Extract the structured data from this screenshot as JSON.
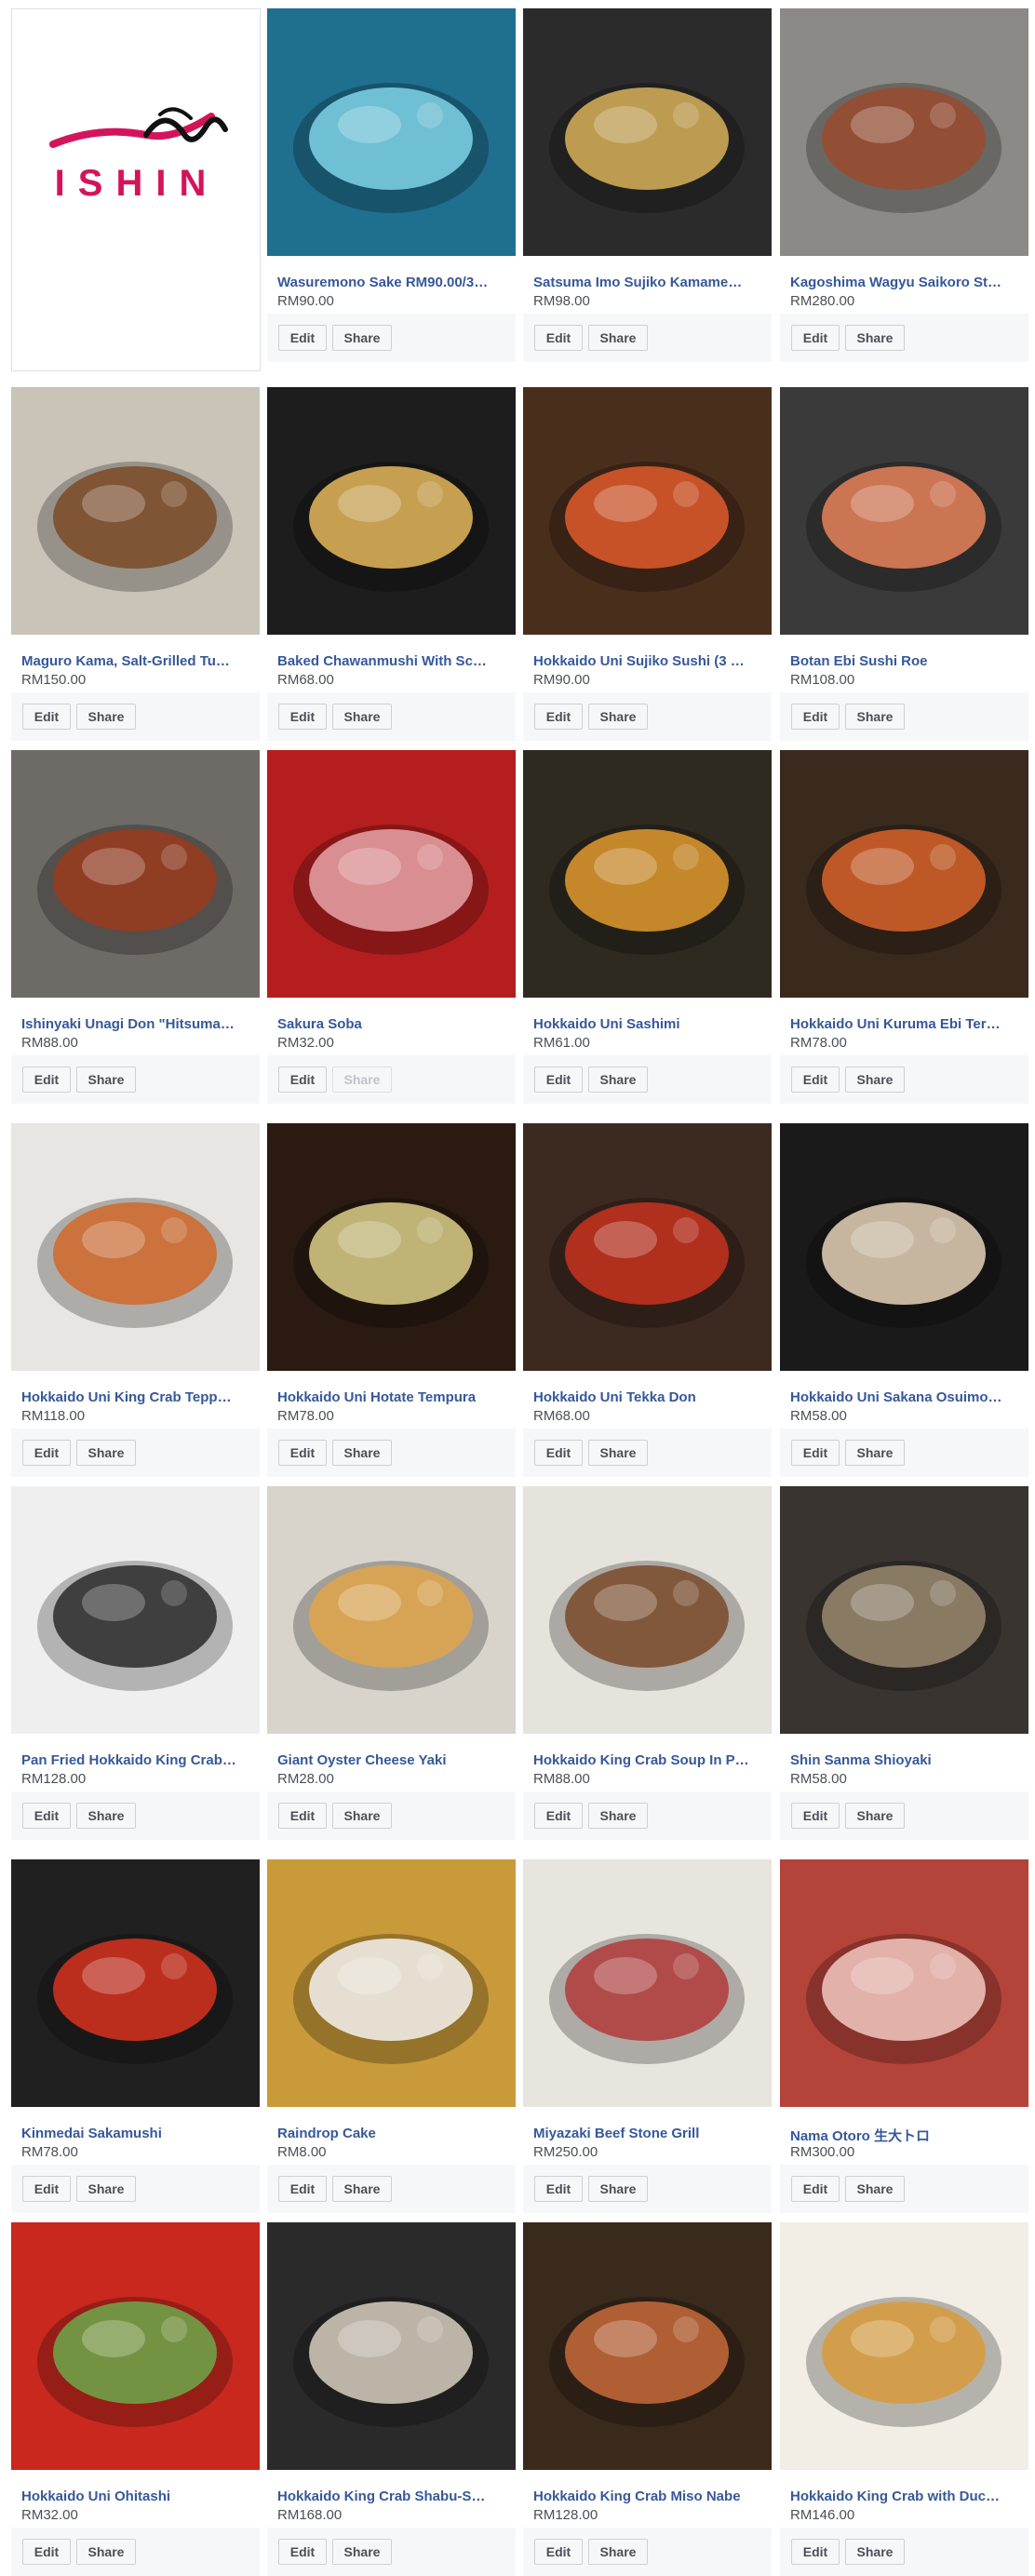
{
  "logo": {
    "text": "ISHIN",
    "color": "#d4145a"
  },
  "buttons": {
    "edit": "Edit",
    "share": "Share"
  },
  "colors": {
    "link": "#365899",
    "price": "#4b4f56",
    "action_bar": "#f6f7f9",
    "brand": "#d4145a"
  },
  "items": [
    {
      "name": "Wasuremono Sake RM90.00/3…",
      "price": "RM90.00",
      "share_enabled": true,
      "bg": "#1f6f8f",
      "accent": "#7fd3e6"
    },
    {
      "name": "Satsuma Imo Sujiko Kamame…",
      "price": "RM98.00",
      "share_enabled": true,
      "bg": "#2b2b2b",
      "accent": "#d9b15a"
    },
    {
      "name": "Kagoshima Wagyu Saikoro St…",
      "price": "RM280.00",
      "share_enabled": true,
      "bg": "#8c8a86",
      "accent": "#9b4a2e"
    },
    {
      "name": "Maguro Kama, Salt-Grilled Tu…",
      "price": "RM150.00",
      "share_enabled": true,
      "bg": "#c9c3b8",
      "accent": "#7b4a26"
    },
    {
      "name": "Baked Chawanmushi With Sc…",
      "price": "RM68.00",
      "share_enabled": true,
      "bg": "#1d1d1d",
      "accent": "#e5b75c"
    },
    {
      "name": "Hokkaido Uni Sujiko Sushi (3 …",
      "price": "RM90.00",
      "share_enabled": true,
      "bg": "#4a2e1c",
      "accent": "#e05a2a"
    },
    {
      "name": "Botan Ebi Sushi Roe",
      "price": "RM108.00",
      "share_enabled": true,
      "bg": "#3a3a3a",
      "accent": "#e8825a"
    },
    {
      "name": "Ishinyaki Unagi Don \"Hitsuma…",
      "price": "RM88.00",
      "share_enabled": true,
      "bg": "#6e6a66",
      "accent": "#9a3a1c"
    },
    {
      "name": "Sakura Soba",
      "price": "RM32.00",
      "share_enabled": false,
      "bg": "#b51e1e",
      "accent": "#e8a3a8"
    },
    {
      "name": "Hokkaido Uni Sashimi",
      "price": "RM61.00",
      "share_enabled": true,
      "bg": "#2e2a20",
      "accent": "#e09a2e"
    },
    {
      "name": "Hokkaido Uni Kuruma Ebi Ter…",
      "price": "RM78.00",
      "share_enabled": true,
      "bg": "#3a2a1e",
      "accent": "#d8642a"
    },
    {
      "name": "Hokkaido Uni King Crab Tepp…",
      "price": "RM118.00",
      "share_enabled": true,
      "bg": "#e8e6e2",
      "accent": "#d0672a"
    },
    {
      "name": "Hokkaido Uni Hotate Tempura",
      "price": "RM78.00",
      "share_enabled": true,
      "bg": "#2a1a12",
      "accent": "#dcd08a"
    },
    {
      "name": "Hokkaido Uni Tekka Don",
      "price": "RM68.00",
      "share_enabled": true,
      "bg": "#3c2a20",
      "accent": "#c8321e"
    },
    {
      "name": "Hokkaido Uni Sakana Osuimo…",
      "price": "RM58.00",
      "share_enabled": true,
      "bg": "#1a1a1a",
      "accent": "#e6d4b8"
    },
    {
      "name": "Pan Fried Hokkaido King Crab…",
      "price": "RM128.00",
      "share_enabled": true,
      "bg": "#efefef",
      "accent": "#2a2a2a"
    },
    {
      "name": "Giant Oyster Cheese Yaki",
      "price": "RM28.00",
      "share_enabled": true,
      "bg": "#d8d4cc",
      "accent": "#e0a54a"
    },
    {
      "name": "Hokkaido King Crab Soup In P…",
      "price": "RM88.00",
      "share_enabled": true,
      "bg": "#e6e2dc",
      "accent": "#7a4a2a"
    },
    {
      "name": "Shin Sanma Shioyaki",
      "price": "RM58.00",
      "share_enabled": true,
      "bg": "#3a3430",
      "accent": "#9a8a70"
    },
    {
      "name": "Kinmedai Sakamushi",
      "price": "RM78.00",
      "share_enabled": true,
      "bg": "#202020",
      "accent": "#d8321e"
    },
    {
      "name": "Raindrop Cake",
      "price": "RM8.00",
      "share_enabled": true,
      "bg": "#c99a3a",
      "accent": "#f4f2ee"
    },
    {
      "name": "Miyazaki Beef Stone Grill",
      "price": "RM250.00",
      "share_enabled": true,
      "bg": "#e8e4de",
      "accent": "#b23a3a"
    },
    {
      "name": "Nama Otoro 生大トロ",
      "price": "RM300.00",
      "share_enabled": true,
      "bg": "#b4433a",
      "accent": "#f2c8c0"
    },
    {
      "name": "Hokkaido Uni Ohitashi",
      "price": "RM32.00",
      "share_enabled": true,
      "bg": "#c8281e",
      "accent": "#6ea84a"
    },
    {
      "name": "Hokkaido King Crab Shabu-S…",
      "price": "RM168.00",
      "share_enabled": true,
      "bg": "#2a2a2a",
      "accent": "#d8d0c0"
    },
    {
      "name": "Hokkaido King Crab Miso Nabe",
      "price": "RM128.00",
      "share_enabled": true,
      "bg": "#3a2a1c",
      "accent": "#c86a3a"
    },
    {
      "name": "Hokkaido King Crab with Duc…",
      "price": "RM146.00",
      "share_enabled": true,
      "bg": "#f2eee6",
      "accent": "#d89a3a"
    }
  ]
}
